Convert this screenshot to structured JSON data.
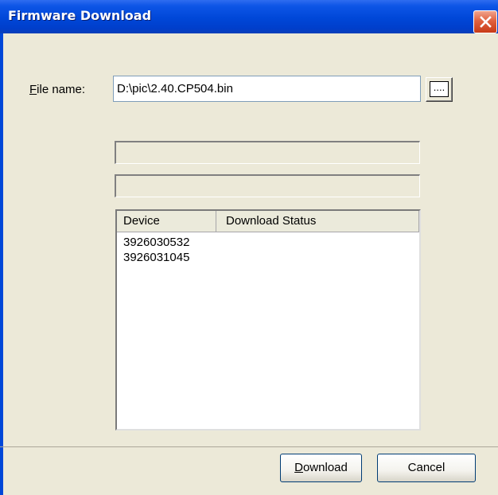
{
  "window": {
    "title": "Firmware Download"
  },
  "form": {
    "file_label_prefix": "",
    "file_label_accel": "F",
    "file_label_rest": "ile name:",
    "file_value": "D:\\pic\\2.40.CP504.bin",
    "browse_label": "...."
  },
  "progress": [
    {
      "value": 0
    },
    {
      "value": 0
    }
  ],
  "table": {
    "columns": [
      "Device",
      "Download Status"
    ],
    "rows": [
      {
        "device": "3926030532",
        "status": ""
      },
      {
        "device": "3926031045",
        "status": ""
      }
    ]
  },
  "buttons": {
    "download_accel": "D",
    "download_rest": "ownload",
    "cancel_label": "Cancel"
  },
  "colors": {
    "titlebar": "#0047d8",
    "dialog_bg": "#ece9d8",
    "close_button": "#d9542e"
  }
}
